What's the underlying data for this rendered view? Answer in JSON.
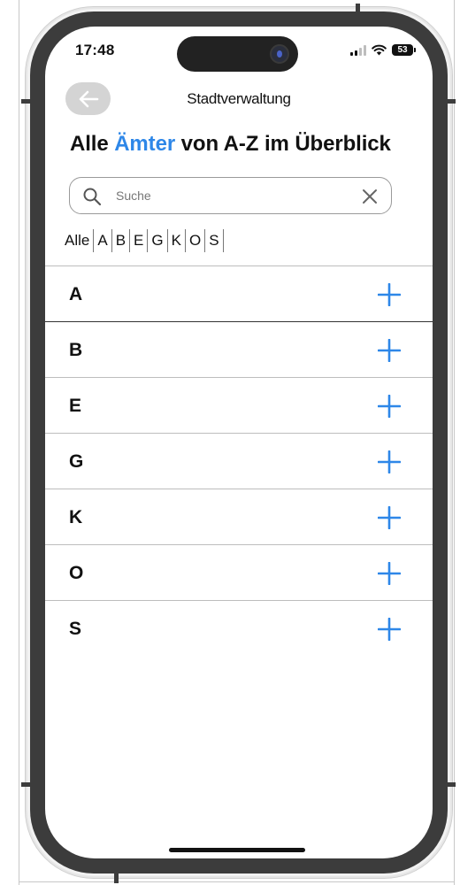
{
  "status_bar": {
    "time": "17:48",
    "battery": "53"
  },
  "header": {
    "title": "Stadtverwaltung",
    "back_icon": "arrow-left-icon"
  },
  "page": {
    "title_before": "Alle",
    "title_accent": "Ämter",
    "title_after": "von A-Z im Überblick",
    "accent_color": "#2e87e8"
  },
  "search": {
    "placeholder": "Suche",
    "value": "",
    "icon": "search-icon",
    "clear_icon": "close-icon"
  },
  "letter_filter": [
    "Alle",
    "A",
    "B",
    "E",
    "G",
    "K",
    "O",
    "S"
  ],
  "sections": [
    {
      "letter": "A",
      "icon": "plus-icon"
    },
    {
      "letter": "B",
      "icon": "plus-icon"
    },
    {
      "letter": "E",
      "icon": "plus-icon"
    },
    {
      "letter": "G",
      "icon": "plus-icon"
    },
    {
      "letter": "K",
      "icon": "plus-icon"
    },
    {
      "letter": "O",
      "icon": "plus-icon"
    },
    {
      "letter": "S",
      "icon": "plus-icon"
    }
  ]
}
